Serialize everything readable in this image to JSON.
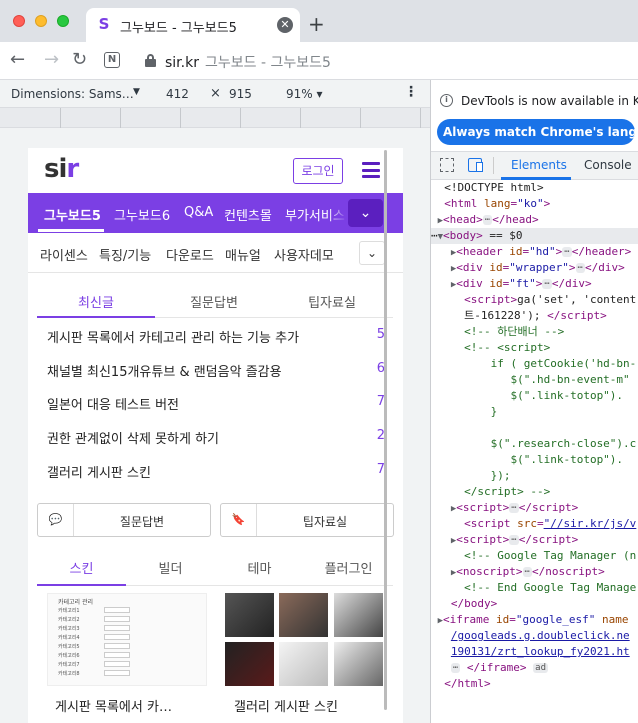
{
  "browser": {
    "tab_title": "그누보드 - 그누보드5",
    "tab_favicon": "S",
    "close_glyph": "✕",
    "newtab_glyph": "+",
    "url_host": "sir.kr",
    "url_rest": "그누보드 - 그누보드5"
  },
  "device_toolbar": {
    "dimensions": "Dimensions: Sams…",
    "width": "412",
    "times": "×",
    "height": "915",
    "zoom": "91% ▾"
  },
  "site": {
    "logo_main": "si",
    "logo_accent": "r",
    "login": "로그인",
    "main_nav": [
      "그누보드5",
      "그누보드6",
      "Q&A",
      "컨텐츠몰",
      "부가서비스"
    ],
    "sub_nav": [
      "라이센스",
      "특징/기능",
      "다운로드",
      "매뉴얼",
      "사용자데모"
    ],
    "toggle_glyph": "⌄",
    "tabs1": [
      "최신글",
      "질문답변",
      "팁자료실"
    ],
    "posts": [
      {
        "title": "게시판 목록에서 카테고리 관리 하는 기능 추가",
        "count": "5"
      },
      {
        "title": "채널별 최신15개유튜브 & 랜덤음악 즐감용",
        "count": "6"
      },
      {
        "title": "일본어 대응 테스트 버전",
        "count": "7"
      },
      {
        "title": "권한 관계없이 삭제 못하게 하기",
        "count": "2"
      },
      {
        "title": "갤러리 게시판 스킨",
        "count": "7"
      }
    ],
    "quick": [
      {
        "icon": "💬",
        "label": "질문답변"
      },
      {
        "icon": "🔖",
        "label": "팁자료실"
      }
    ],
    "tabs2": [
      "스킨",
      "빌더",
      "테마",
      "플러그인"
    ],
    "thumb_titles": [
      "게시판 목록에서 카…",
      "갤러리 게시판 스킨"
    ],
    "thumb_mini_title": "카테고리 관리",
    "thumb_rows": [
      "카테고리1",
      "카테고리2",
      "카테고리3",
      "카테고리4",
      "카테고리5",
      "카테고리6",
      "카테고리7",
      "카테고리8"
    ]
  },
  "devtools": {
    "info": "DevTools is now available in Korean",
    "match_button": "Always match Chrome's language",
    "tabs": [
      "Elements",
      "Console"
    ],
    "more_glyph": "⋮"
  },
  "colors": {
    "brand": "#7b3fe4",
    "brand_dark": "#5b1fbf",
    "devtools_accent": "#1a73e8"
  }
}
